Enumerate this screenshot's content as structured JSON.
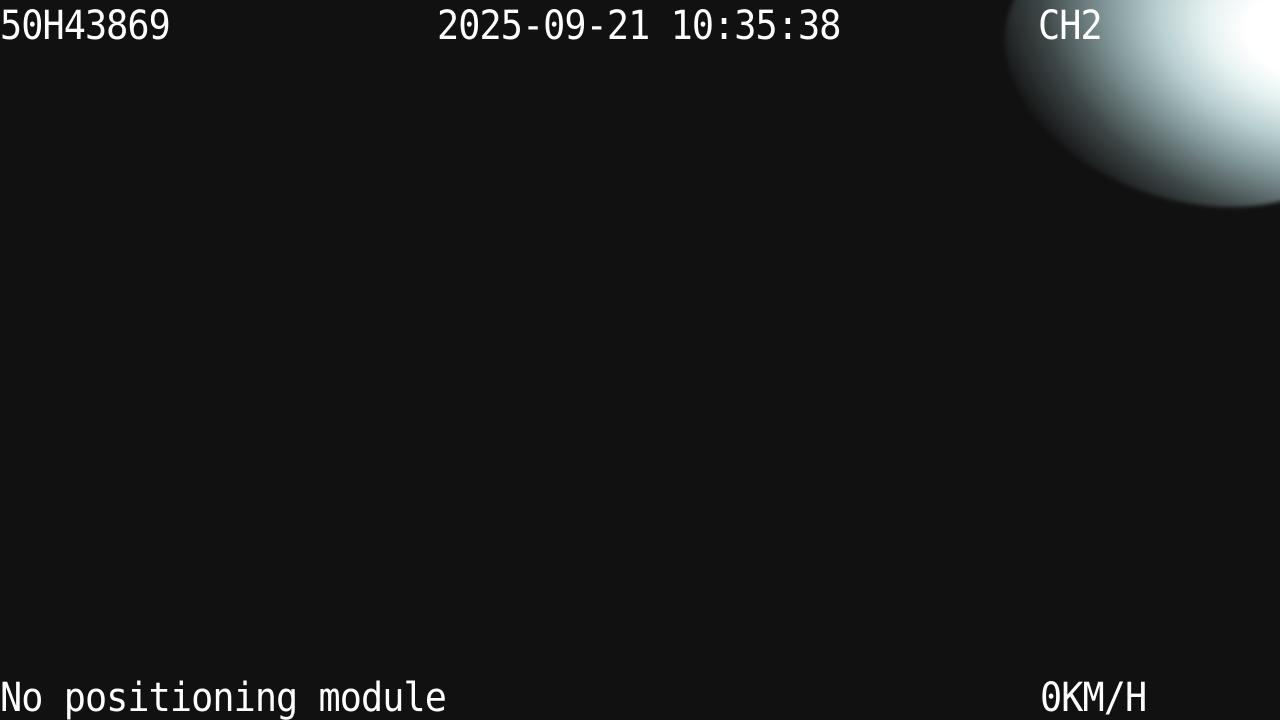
{
  "osd": {
    "plate": "50H43869",
    "datetime": "2025-09-21 10:35:38",
    "channel": "CH2",
    "gps_status": "No positioning module",
    "speed": "0KM/H"
  },
  "colors": {
    "background": "#111111",
    "text": "#ffffff",
    "glare": "#e6f1f1"
  }
}
